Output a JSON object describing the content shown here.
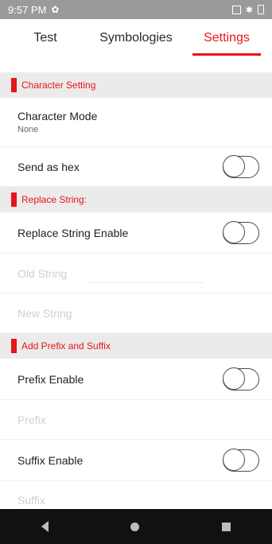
{
  "status_bar": {
    "time": "9:57 PM"
  },
  "tabs": [
    {
      "label": "Test"
    },
    {
      "label": "Symbologies"
    },
    {
      "label": "Settings"
    }
  ],
  "sections": {
    "character": {
      "title": "Character Setting",
      "character_mode": {
        "label": "Character Mode",
        "value": "None"
      },
      "send_as_hex": {
        "label": "Send as hex",
        "enabled": false
      }
    },
    "replace": {
      "title": "Replace String:",
      "enable": {
        "label": "Replace String Enable",
        "enabled": false
      },
      "old_string": {
        "placeholder": "Old String"
      },
      "new_string": {
        "placeholder": "New String"
      }
    },
    "prefix_suffix": {
      "title": "Add Prefix and Suffix",
      "prefix_enable": {
        "label": "Prefix Enable",
        "enabled": false
      },
      "prefix": {
        "placeholder": "Prefix"
      },
      "suffix_enable": {
        "label": "Suffix Enable",
        "enabled": false
      },
      "suffix": {
        "placeholder": "Suffix"
      }
    }
  }
}
